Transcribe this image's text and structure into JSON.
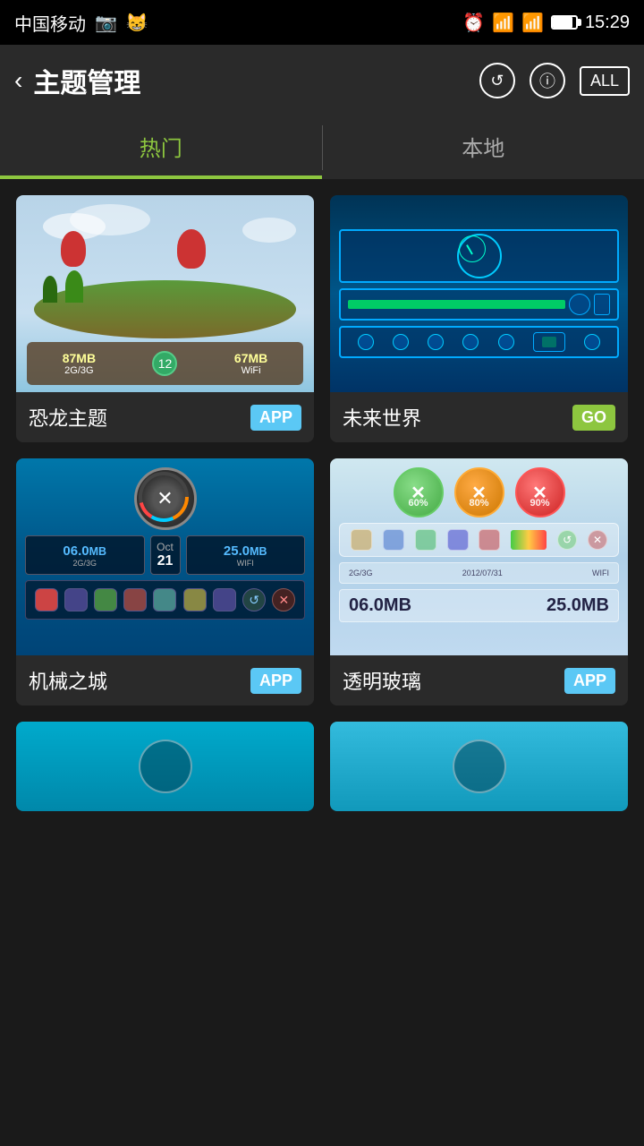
{
  "statusBar": {
    "carrier": "中国移动",
    "time": "15:29"
  },
  "titleBar": {
    "back": "‹",
    "title": "主题管理",
    "resetIcon": "↺",
    "infoIcon": "ⓘ",
    "allLabel": "ALL"
  },
  "tabs": [
    {
      "id": "hot",
      "label": "热门",
      "active": true
    },
    {
      "id": "local",
      "label": "本地",
      "active": false
    }
  ],
  "themes": [
    {
      "id": "dinosaur",
      "name": "恐龙主题",
      "badge": "APP",
      "badgeType": "app"
    },
    {
      "id": "future",
      "name": "未来世界",
      "badge": "GO",
      "badgeType": "go"
    },
    {
      "id": "mech",
      "name": "机械之城",
      "badge": "APP",
      "badgeType": "app"
    },
    {
      "id": "glass",
      "name": "透明玻璃",
      "badge": "APP",
      "badgeType": "app"
    }
  ],
  "mechWidget": {
    "val1": "06.0MB",
    "lbl1": "2G/3G",
    "val2": "25.0MB",
    "lbl2": "WIFI"
  },
  "glassWidget": {
    "pct1": "60%",
    "pct2": "80%",
    "pct3": "90%",
    "lbl2g": "2G/3G",
    "date": "2012/07/31",
    "wifi": "WIFI",
    "val1": "06.0MB",
    "val2": "25.0MB"
  }
}
